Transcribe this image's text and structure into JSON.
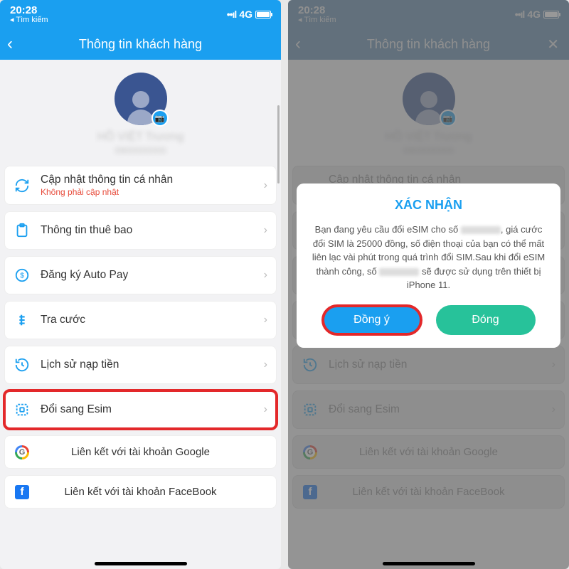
{
  "status": {
    "time": "20:28",
    "search_hint": "◂ Tìm kiếm",
    "signal": "••ıl",
    "net": "4G",
    "batt": ""
  },
  "nav": {
    "title": "Thông tin khách hàng"
  },
  "profile": {
    "name_blurred": "HỒ VIỆT Trương",
    "phone_blurred": "0900000000"
  },
  "rows": {
    "update": {
      "label": "Cập nhật thông tin cá nhân",
      "sub": "Không phải cập nhật"
    },
    "sub_info": {
      "label": "Thông tin thuê bao"
    },
    "autopay": {
      "label": "Đăng ký Auto Pay"
    },
    "charges": {
      "label": "Tra cước"
    },
    "topup_hist": {
      "label": "Lịch sử nạp tiền"
    },
    "esim": {
      "label": "Đổi sang Esim"
    },
    "google": {
      "label": "Liên kết với tài khoản Google"
    },
    "facebook": {
      "label": "Liên kết với tài khoản FaceBook"
    }
  },
  "modal": {
    "title": "XÁC NHẬN",
    "msg_pre": "Bạn đang yêu cầu đổi eSIM cho số ",
    "msg_mid": ", giá cước đổi SIM là 25000 đồng, số điện thoại của bạn có thể mất liên lạc vài phút trong quá trình đổi SIM.Sau khi đổi eSIM thành công, số ",
    "msg_post": " sẽ được sử dụng trên thiết bị iPhone 11.",
    "agree": "Đồng ý",
    "close": "Đóng"
  }
}
